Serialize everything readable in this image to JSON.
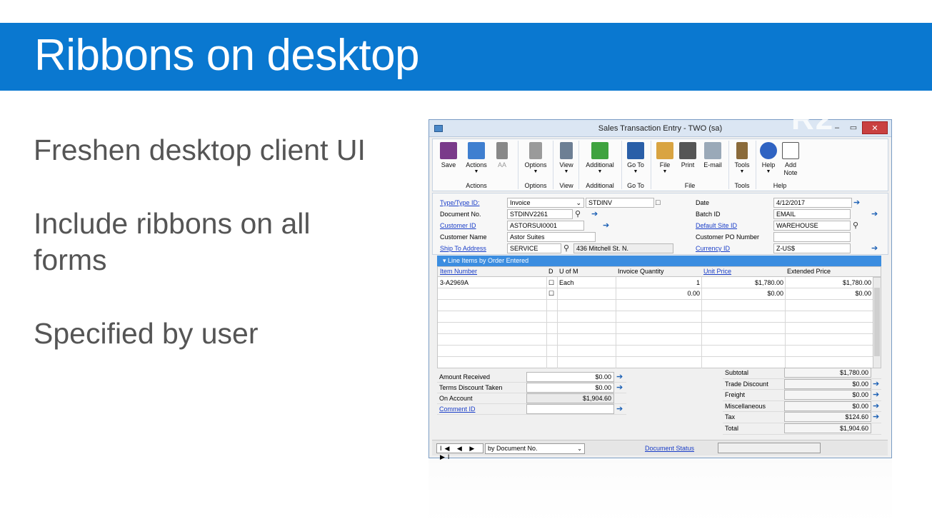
{
  "slide": {
    "title": "Ribbons on desktop",
    "bullets": [
      "Freshen desktop client UI",
      "Include ribbons on all forms",
      "Specified by user"
    ]
  },
  "window": {
    "title": "Sales Transaction Entry  -  TWO (sa)",
    "min": "–",
    "max": "▭",
    "close": "✕"
  },
  "ribbon": {
    "buttons": [
      {
        "label": "Save",
        "icon": "save-icon",
        "color": "#7a3a8a"
      },
      {
        "label": "Actions",
        "icon": "actions-icon",
        "color": "#3f7fd0"
      },
      {
        "label": "AA",
        "icon": "hierarchy-icon",
        "color": "#888888"
      },
      {
        "label": "Options",
        "icon": "options-icon",
        "color": "#9a9a9a"
      },
      {
        "label": "View",
        "icon": "view-icon",
        "color": "#6d7f94"
      },
      {
        "label": "Additional",
        "icon": "additional-icon",
        "color": "#3fa33f"
      },
      {
        "label": "Go To",
        "icon": "goto-icon",
        "color": "#2a5fa8"
      },
      {
        "label": "File",
        "icon": "folder-icon",
        "color": "#d9a441"
      },
      {
        "label": "Print",
        "icon": "printer-icon",
        "color": "#555555"
      },
      {
        "label": "E-mail",
        "icon": "email-icon",
        "color": "#9aa9b8"
      },
      {
        "label": "Tools",
        "icon": "tools-icon",
        "color": "#8a6a3a"
      },
      {
        "label": "Help",
        "icon": "help-icon",
        "color": "#2f63c2"
      },
      {
        "label": "Add Note",
        "icon": "note-icon",
        "color": "#e5b62b"
      }
    ],
    "groups": [
      "Actions",
      "Options",
      "View",
      "Additional",
      "Go To",
      "File",
      "Tools",
      "Help"
    ]
  },
  "header": {
    "type_label": "Type/Type ID:",
    "type_value": "Invoice",
    "type_id": "STDINV",
    "docno_label": "Document No.",
    "docno_value": "STDINV2261",
    "customer_label": "Customer ID",
    "customer_value": "ASTORSUI0001",
    "custname_label": "Customer Name",
    "custname_value": "Astor Suites",
    "shipto_label": "Ship To Address",
    "shipto_value": "SERVICE",
    "shipto_addr": "436 Mitchell St. N.",
    "date_label": "Date",
    "date_value": "4/12/2017",
    "batch_label": "Batch ID",
    "batch_value": "EMAIL",
    "site_label": "Default Site ID",
    "site_value": "WAREHOUSE",
    "po_label": "Customer PO Number",
    "po_value": "",
    "currency_label": "Currency ID",
    "currency_value": "Z-US$"
  },
  "grid": {
    "title": "Line Items by Order Entered",
    "columns": [
      "Item Number",
      "D",
      "U of M",
      "Invoice Quantity",
      "Unit Price",
      "Extended Price"
    ],
    "rows": [
      {
        "item": "3-A2969A",
        "uom": "Each",
        "qty": "1",
        "price": "$1,780.00",
        "ext": "$1,780.00"
      },
      {
        "item": "",
        "uom": "",
        "qty": "0.00",
        "price": "$0.00",
        "ext": "$0.00"
      }
    ]
  },
  "totals_left": [
    {
      "label": "Amount Received",
      "value": "$0.00"
    },
    {
      "label": "Terms Discount Taken",
      "value": "$0.00"
    },
    {
      "label": "On Account",
      "value": "$1,904.60"
    },
    {
      "label": "Comment ID",
      "value": ""
    }
  ],
  "totals_right": [
    {
      "label": "Subtotal",
      "value": "$1,780.00"
    },
    {
      "label": "Trade Discount",
      "value": "$0.00"
    },
    {
      "label": "Freight",
      "value": "$0.00"
    },
    {
      "label": "Miscellaneous",
      "value": "$0.00"
    },
    {
      "label": "Tax",
      "value": "$124.60"
    },
    {
      "label": "Total",
      "value": "$1,904.60"
    }
  ],
  "nav": {
    "buttons": "I◀ ◀ ▶ ▶I",
    "sort": "by Document No.",
    "doc_status": "Document Status"
  },
  "watermark": "R2"
}
